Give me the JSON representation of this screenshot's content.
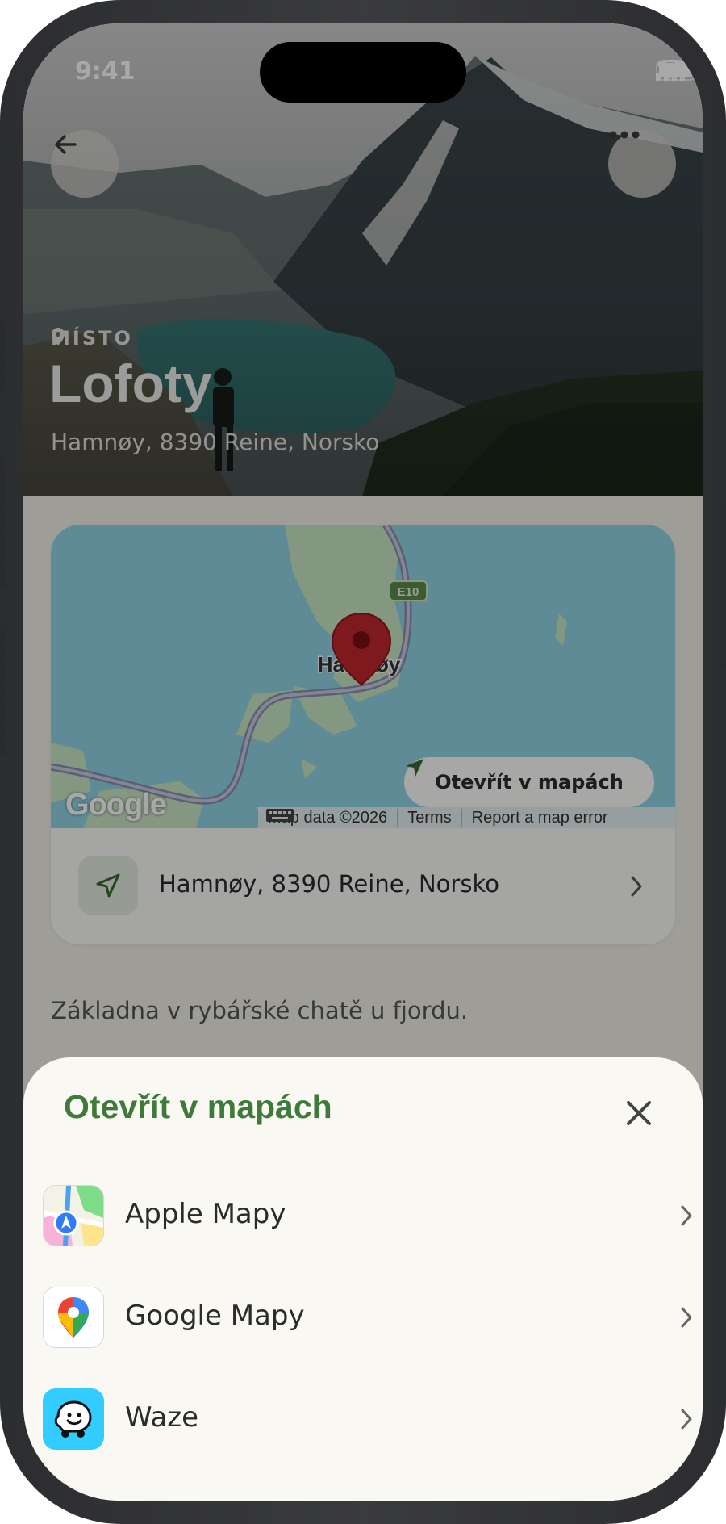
{
  "status_bar": {
    "time": "9:41"
  },
  "place": {
    "kicker": "MÍSTO",
    "title": "Lofoty",
    "address": "Hamnøy, 8390 Reine, Norsko",
    "description": "Základna v rybářské chatě u fjordu."
  },
  "map": {
    "place_label": "Hamnøy",
    "road_badge": "E10",
    "open_button": "Otevřít v mapách",
    "google_logo": "Google",
    "attribution": [
      "Map data ©2026",
      "Terms",
      "Report a map error"
    ]
  },
  "sheet": {
    "title": "Otevřít v mapách",
    "apps": [
      {
        "label": "Apple Mapy",
        "icon": "apple-maps-icon"
      },
      {
        "label": "Google Mapy",
        "icon": "google-maps-icon"
      },
      {
        "label": "Waze",
        "icon": "waze-icon"
      }
    ]
  },
  "colors": {
    "accent_green": "#3e7a3a",
    "sheet_bg": "#faf8f3",
    "map_water": "#8fd4e4",
    "pin_red": "#c0262c"
  }
}
